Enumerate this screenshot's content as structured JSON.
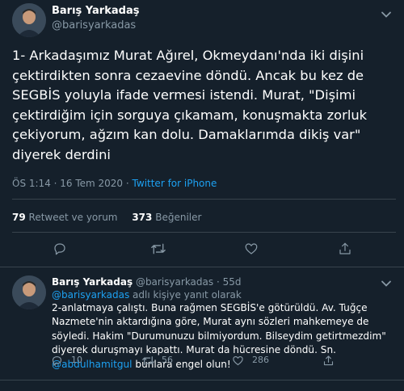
{
  "main_tweet": {
    "author_name": "Barış Yarkadaş",
    "handle": "@barisyarkadas",
    "text": "1- Arkadaşımız Murat Ağırel, Okmeydanı'nda iki dişini çektirdikten sonra cezaevine döndü. Ancak bu kez de SEGBİS yoluyla ifade vermesi istendi. Murat, \"Dişimi çektirdiğim için sorguya çıkamam, konuşmakta zorluk çekiyorum, ağzım kan dolu. Damaklarımda dikiş var\" diyerek derdini",
    "timestamp": "ÖS 1:14 · 16 Tem 2020 ·",
    "source": "Twitter for iPhone",
    "retweets_count": "79",
    "retweets_label": "Retweet ve yorum",
    "likes_count": "373",
    "likes_label": "Beğeniler"
  },
  "reply": {
    "author_name": "Barış Yarkadaş",
    "handle_time": "@barisyarkadas · 55d",
    "replying_to_handle": "@barisyarkadas",
    "replying_to_suffix": "adlı kişiye yanıt olarak",
    "text": "2-anlatmaya çalıştı. Buna rağmen SEGBİS'e götürüldü. Av. Tuğçe Nazmete'nin aktardığına göre, Murat aynı sözleri mahkemeye de söyledi. Hakim \"Durumunuzu bilmiyordum. Bilseydim getirtmezdim\" diyerek duruşmayı kapattı. Murat da hücresine döndü. Sn.",
    "mention": "@abdulhamitgul",
    "text_end": "bunlara engel olun!",
    "reply_count": "10",
    "retweet_count": "56",
    "like_count": "286"
  },
  "colors": {
    "background": "#15202b",
    "muted": "#8899a6",
    "accent": "#1da1f2",
    "divider": "#38444d"
  },
  "icons": [
    "chevron-down-icon",
    "reply-icon",
    "retweet-icon",
    "like-icon",
    "share-icon"
  ]
}
